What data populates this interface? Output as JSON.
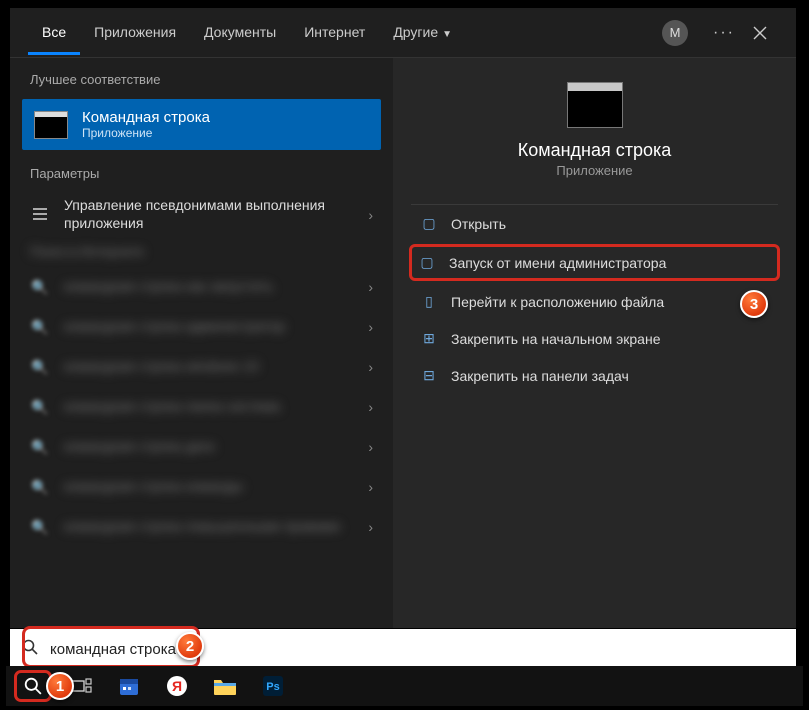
{
  "header": {
    "tabs": [
      {
        "label": "Все",
        "active": true
      },
      {
        "label": "Приложения"
      },
      {
        "label": "Документы"
      },
      {
        "label": "Интернет"
      },
      {
        "label": "Другие",
        "dropdown": true
      }
    ],
    "avatar_letter": "M"
  },
  "left": {
    "best_match_label": "Лучшее соответствие",
    "best_match": {
      "title": "Командная строка",
      "subtitle": "Приложение"
    },
    "settings_label": "Параметры",
    "settings_item": "Управление псевдонимами выполнения приложения",
    "web_label": "Поиск в Интернете",
    "blur_items": [
      "командная строка как запустить",
      "командная строка администратор",
      "командная строка windows 10",
      "командная строка папка система",
      "командная строка диск",
      "командная строка команды",
      "командная строка повышенными правами"
    ]
  },
  "right": {
    "app_title": "Командная строка",
    "app_subtitle": "Приложение",
    "actions": [
      {
        "icon": "open",
        "label": "Открыть"
      },
      {
        "icon": "admin",
        "label": "Запуск от имени администратора",
        "highlight": true
      },
      {
        "icon": "folder",
        "label": "Перейти к расположению файла"
      },
      {
        "icon": "pin-start",
        "label": "Закрепить на начальном экране"
      },
      {
        "icon": "pin-task",
        "label": "Закрепить на панели задач"
      }
    ]
  },
  "search": {
    "value": "командная строка"
  },
  "taskbar": {
    "icons": [
      "search",
      "task-view",
      "calendar",
      "yandex",
      "explorer",
      "photoshop"
    ]
  },
  "badges": {
    "b1": "1",
    "b2": "2",
    "b3": "3"
  }
}
